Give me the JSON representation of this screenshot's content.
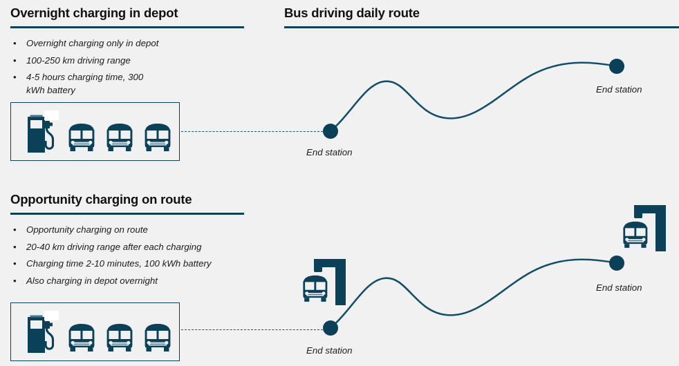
{
  "theme": {
    "background": "#f1f1f1",
    "accent": "#0a4159",
    "line": "#11506a",
    "text": "#1b1b1b"
  },
  "left_column": {
    "sections": [
      {
        "id": "overnight",
        "title": "Overnight charging in depot",
        "bullet_marker": "•",
        "bullets": [
          "Overnight charging only in depot",
          "100-250 km driving range",
          "4-5 hours charging time, 300 kWh battery"
        ],
        "icon_panel": {
          "name": "depot-charging-panel",
          "icons": [
            "charging-pump-icon",
            "bus-front-icon",
            "bus-front-icon",
            "bus-front-icon"
          ]
        }
      },
      {
        "id": "opportunity",
        "title": "Opportunity charging on route",
        "bullet_marker": "•",
        "bullets": [
          "Opportunity charging on route",
          "20-40 km driving range after each charging",
          "Charging time 2-10 minutes, 100 kWh battery",
          "Also charging in depot overnight"
        ],
        "icon_panel": {
          "name": "depot-charging-panel",
          "icons": [
            "charging-pump-icon",
            "bus-front-icon",
            "bus-front-icon",
            "bus-front-icon"
          ]
        }
      }
    ]
  },
  "right_column": {
    "title": "Bus driving daily route",
    "routes": [
      {
        "id": "route-overnight",
        "start_label": "End station",
        "end_label": "End station",
        "has_pantograph_stations": false
      },
      {
        "id": "route-opportunity",
        "start_label": "End station",
        "end_label": "End station",
        "has_pantograph_stations": true,
        "station_icons": [
          "pantograph-charging-station-icon",
          "pantograph-charging-station-icon"
        ]
      }
    ]
  }
}
